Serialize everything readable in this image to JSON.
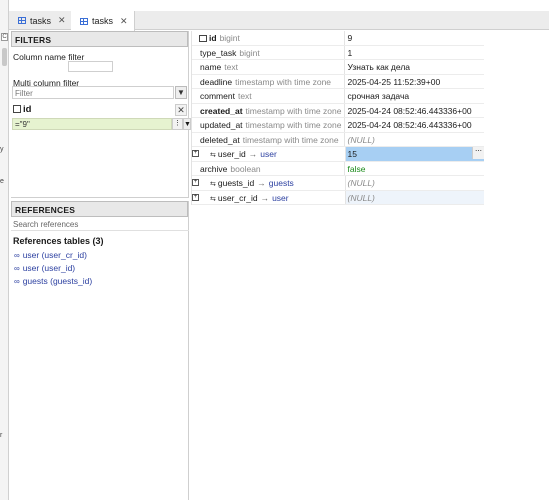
{
  "edge": {
    "icon_glyph": "C",
    "chars": [
      "y",
      "e",
      "r"
    ]
  },
  "tabs": [
    {
      "label": "tasks",
      "icon": "table-icon",
      "close": "✕",
      "active": false
    },
    {
      "label": "tasks",
      "icon": "table-icon",
      "close": "✕",
      "active": true
    }
  ],
  "filters": {
    "title": "FILTERS",
    "column_name_filter_label": "Column name filter",
    "column_name_filter_value": "",
    "multi_column_filter_label": "Multi column filter",
    "multi_column_filter_placeholder": "Filter",
    "column_filter": {
      "name": "id",
      "value": "=\"9\""
    }
  },
  "references": {
    "title": "REFERENCES",
    "search_placeholder": "Search references",
    "tables_title": "References tables (3)",
    "items": [
      "user (user_cr_id)",
      "user (user_id)",
      "guests (guests_id)"
    ]
  },
  "record": [
    {
      "name": "id",
      "type": "bigint",
      "value": "9",
      "bold": true,
      "pk": true
    },
    {
      "name": "type_task",
      "type": "bigint",
      "value": "1"
    },
    {
      "name": "name",
      "type": "text",
      "value": "Узнать как дела"
    },
    {
      "name": "deadline",
      "type": "timestamp with time zone",
      "value": "2025-04-25 11:52:39+00"
    },
    {
      "name": "comment",
      "type": "text",
      "value": "срочная задача"
    },
    {
      "name": "created_at",
      "type": "timestamp with time zone",
      "value": "2025-04-24 08:52:46.443336+00",
      "bold": true
    },
    {
      "name": "updated_at",
      "type": "timestamp with time zone",
      "value": "2025-04-24 08:52:46.443336+00"
    },
    {
      "name": "deleted_at",
      "type": "timestamp with time zone",
      "value": "(NULL)",
      "null": true
    },
    {
      "name": "user_id",
      "ref": "user",
      "value": "15",
      "fk": true,
      "selected": true,
      "more": "⋯"
    },
    {
      "name": "archive",
      "type": "boolean",
      "value": "false",
      "boolean": true
    },
    {
      "name": "guests_id",
      "ref": "guests",
      "value": "(NULL)",
      "fk": true,
      "null": true
    },
    {
      "name": "user_cr_id",
      "ref": "user",
      "value": "(NULL)",
      "fk": true,
      "null": true,
      "highlight": true
    }
  ],
  "symbols": {
    "expand": "+",
    "arrow": "→",
    "fk": "⇆",
    "funnel": "▼",
    "dots": "⋮",
    "close": "✕",
    "link": "∞"
  }
}
